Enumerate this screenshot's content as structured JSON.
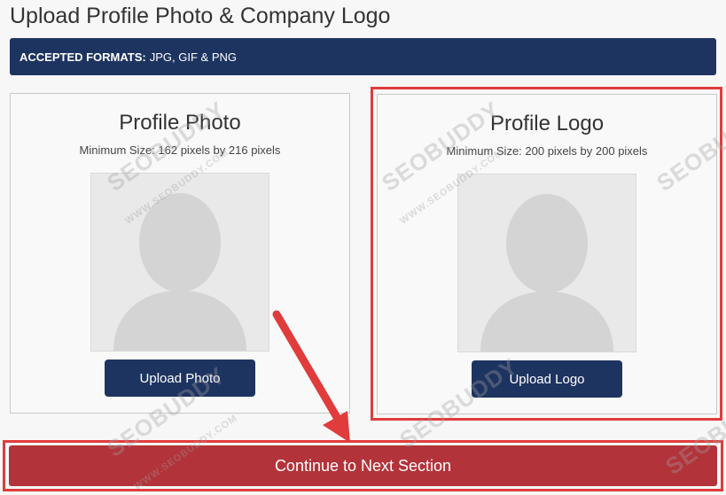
{
  "page": {
    "title": "Upload Profile Photo & Company Logo",
    "banner_label": "ACCEPTED FORMATS:",
    "banner_formats": "JPG, GIF & PNG"
  },
  "photo_card": {
    "title": "Profile Photo",
    "subtitle": "Minimum Size: 162 pixels by 216 pixels",
    "button_label": "Upload Photo",
    "placeholder_icon": "person-silhouette-icon"
  },
  "logo_card": {
    "title": "Profile Logo",
    "subtitle": "Minimum Size: 200 pixels by 200 pixels",
    "button_label": "Upload Logo",
    "placeholder_icon": "person-silhouette-icon"
  },
  "continue_button": {
    "label": "Continue to Next Section"
  },
  "annotations": {
    "highlight_color": "#e03c3c",
    "watermark_text": "SEOBUDDY",
    "watermark_subtext": "WWW.SEOBUDDY.COM"
  },
  "colors": {
    "navy": "#1e3460",
    "continue_red": "#b3333a",
    "placeholder_bg": "#e9e9ea"
  }
}
